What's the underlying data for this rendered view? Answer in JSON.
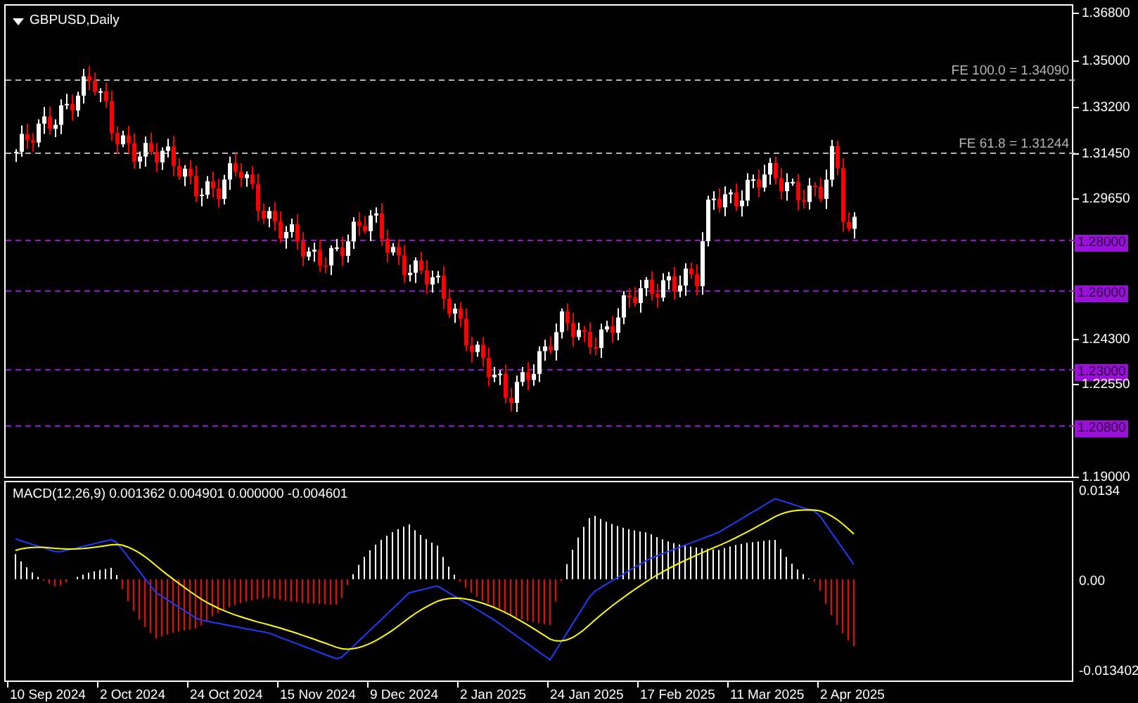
{
  "chart_title": "GBPUSD,Daily",
  "fib_levels": [
    {
      "label": "FE 100.0 = 1.34090"
    },
    {
      "label": "FE 61.8 = 1.31244"
    }
  ],
  "support_levels": [
    {
      "label": "1.28000"
    },
    {
      "label": "1.26000"
    },
    {
      "label": "1.23000"
    },
    {
      "label": "1.20800"
    }
  ],
  "price_axis": [
    "1.36800",
    "1.35000",
    "1.33200",
    "1.31450",
    "1.29650",
    "1.24300",
    "1.22550",
    "1.19000"
  ],
  "macd": {
    "title": "MACD(12,26,9) 0.001362 0.004901 0.000000 -0.004601",
    "axis": [
      "0.0134",
      "0.00",
      "-0.013402"
    ]
  },
  "time_axis": [
    "10 Sep 2024",
    "2 Oct 2024",
    "24 Oct 2024",
    "15 Nov 2024",
    "9 Dec 2024",
    "2 Jan 2025",
    "24 Jan 2025",
    "17 Feb 2025",
    "11 Mar 2025",
    "2 Apr 2025"
  ]
}
